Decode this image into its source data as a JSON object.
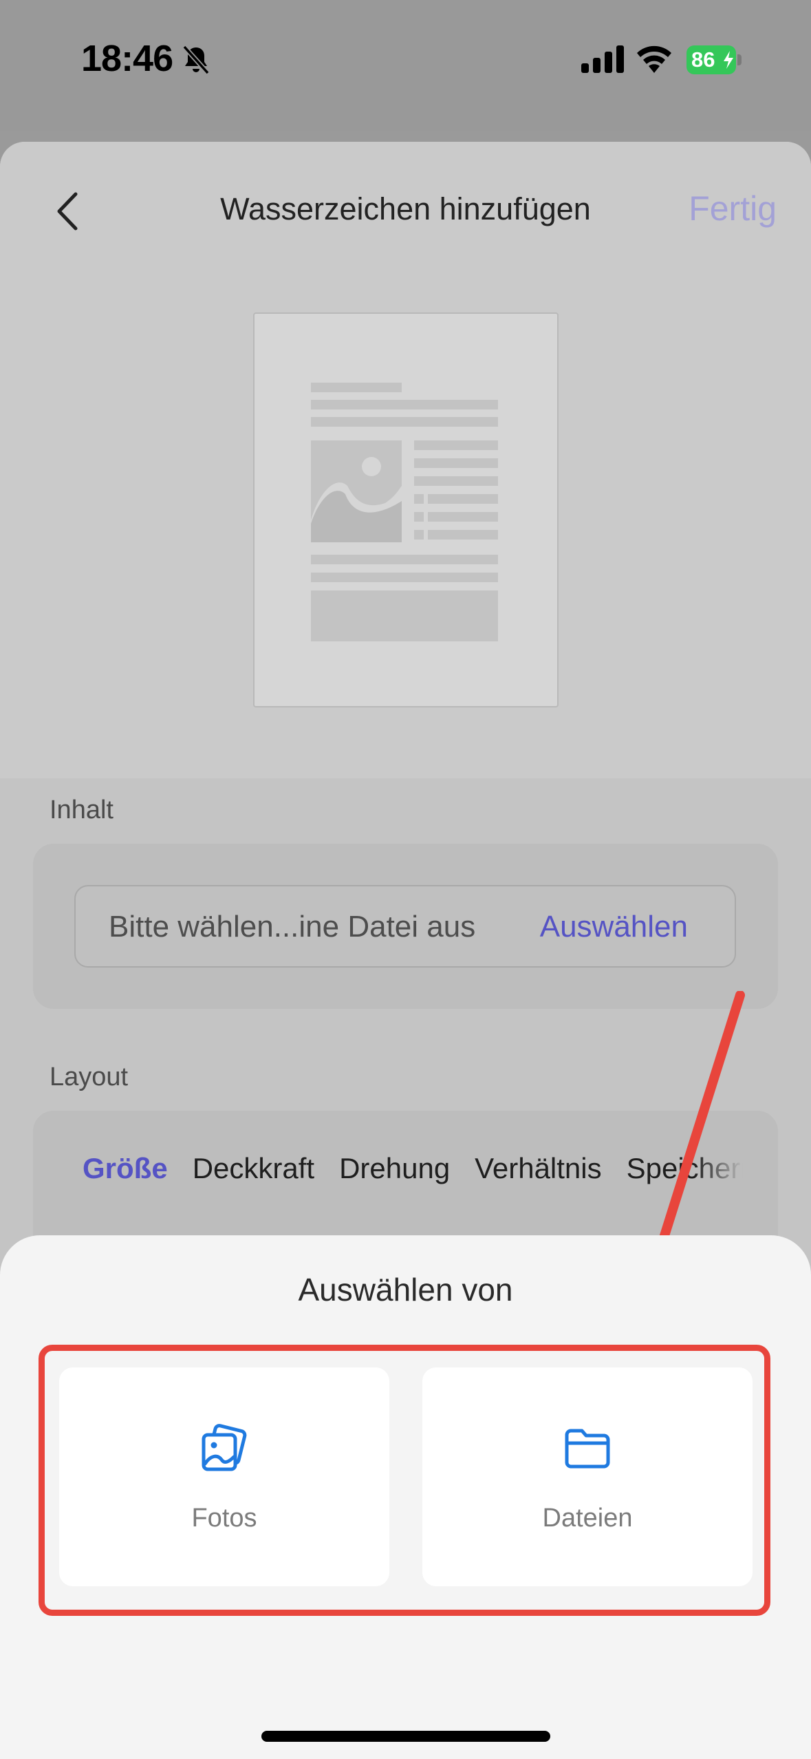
{
  "status_bar": {
    "time": "18:46",
    "battery_level": "86",
    "battery_color": "#34c759"
  },
  "nav": {
    "title": "Wasserzeichen hinzufügen",
    "done_label": "Fertig",
    "back_icon": "chevron-left-icon"
  },
  "content_section": {
    "label": "Inhalt",
    "field_text": "Bitte wählen...ine Datei aus",
    "select_label": "Auswählen"
  },
  "layout_section": {
    "label": "Layout",
    "tabs": [
      {
        "label": "Größe",
        "active": true
      },
      {
        "label": "Deckkraft",
        "active": false
      },
      {
        "label": "Drehung",
        "active": false
      },
      {
        "label": "Verhältnis",
        "active": false
      },
      {
        "label": "Speichern",
        "active": false
      }
    ]
  },
  "sheet": {
    "title": "Auswählen von",
    "options": [
      {
        "label": "Fotos",
        "icon": "photos-icon"
      },
      {
        "label": "Dateien",
        "icon": "folder-icon"
      }
    ]
  },
  "colors": {
    "accent": "#5553c4",
    "icon_blue": "#1f7ae0",
    "annotation_red": "#e8453c"
  }
}
